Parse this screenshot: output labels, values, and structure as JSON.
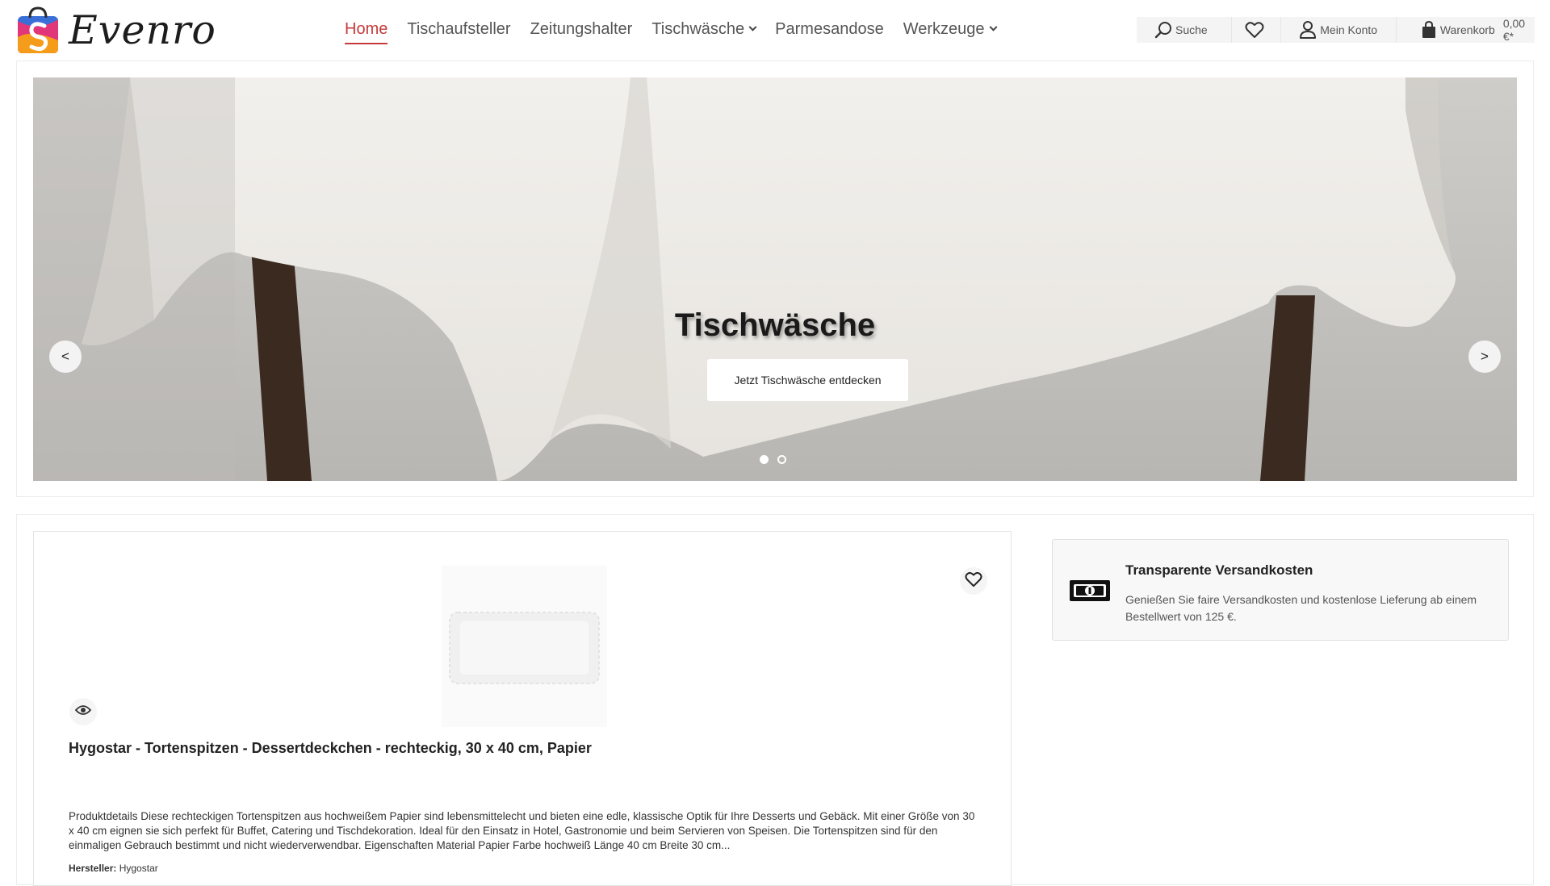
{
  "brand": {
    "name": "Evenro"
  },
  "nav": {
    "items": [
      {
        "label": "Home"
      },
      {
        "label": "Tischaufsteller"
      },
      {
        "label": "Zeitungshalter"
      },
      {
        "label": "Tischwäsche"
      },
      {
        "label": "Parmesandose"
      },
      {
        "label": "Werkzeuge"
      }
    ]
  },
  "header_actions": {
    "search": "Suche",
    "account": "Mein Konto",
    "cart": "Warenkorb",
    "cart_total": "0,00 €*"
  },
  "hero": {
    "title": "Tischwäsche",
    "button": "Jetzt Tischwäsche entdecken",
    "prev": "<",
    "next": ">",
    "active_slide": 1,
    "slide_count": 2
  },
  "product": {
    "title": "Hygostar - Tortenspitzen - Dessertdeckchen - rechteckig, 30 x 40 cm, Papier",
    "description": "Produktdetails Diese rechteckigen Tortenspitzen aus hochweißem Papier sind lebensmittelecht und bieten eine edle, klassische Optik für Ihre Desserts und Gebäck. Mit einer Größe von 30 x 40 cm eignen sie sich perfekt für Buffet, Catering und Tischdekoration. Ideal für den Einsatz in Hotel, Gastronomie und beim Servieren von Speisen. Die Tortenspitzen sind für den einmaligen Gebrauch bestimmt und nicht wiederverwendbar. Eigenschaften Material Papier Farbe hochweiß Länge 40 cm Breite 30 cm...",
    "maker_label": "Hersteller:",
    "maker": "Hygostar"
  },
  "shipping": {
    "title": "Transparente Versandkosten",
    "text": "Genießen Sie faire Versandkosten und kostenlose Lieferung ab einem Bestellwert von 125 €."
  },
  "colors": {
    "accent": "#c53a3a"
  },
  "icons": [
    "search-icon",
    "heart-icon",
    "user-icon",
    "bag-icon",
    "eye-icon",
    "banknote-icon",
    "chevron-down-icon"
  ]
}
